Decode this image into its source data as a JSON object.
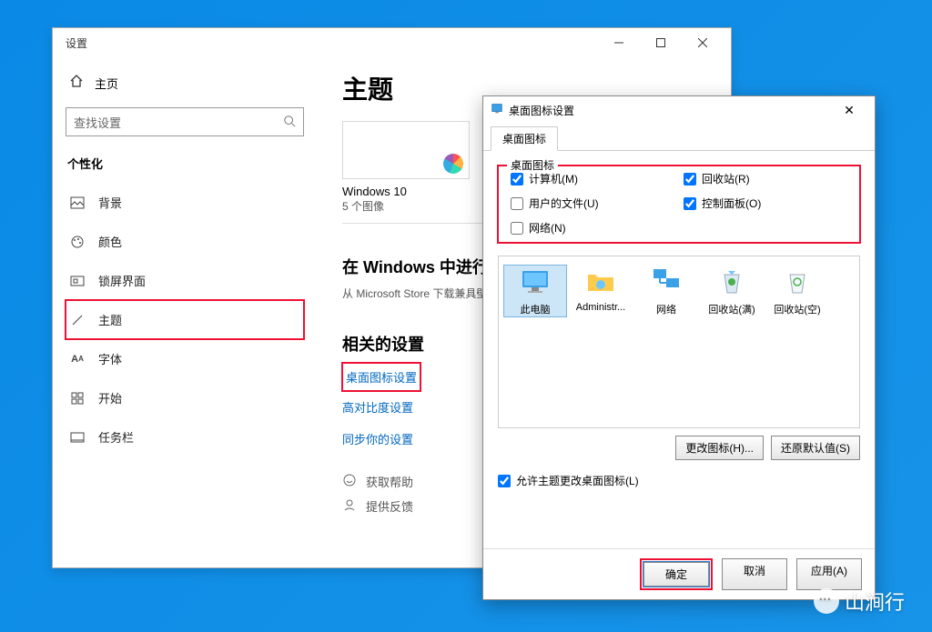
{
  "settings": {
    "title": "设置",
    "home": "主页",
    "search_placeholder": "查找设置",
    "section": "个性化",
    "nav": [
      {
        "label": "背景",
        "icon": "picture-icon"
      },
      {
        "label": "颜色",
        "icon": "palette-icon"
      },
      {
        "label": "锁屏界面",
        "icon": "lock-icon"
      },
      {
        "label": "主题",
        "icon": "brush-icon",
        "selected": true
      },
      {
        "label": "字体",
        "icon": "font-icon"
      },
      {
        "label": "开始",
        "icon": "start-icon"
      },
      {
        "label": "任务栏",
        "icon": "taskbar-icon"
      }
    ],
    "main": {
      "heading": "主题",
      "theme_name": "Windows 10",
      "theme_sub": "5 个图像",
      "more_heading": "在 Windows 中进行更多个性化设置",
      "more_sub": "从 Microsoft Store 下载兼具壁纸、声音和颜色的免费主题",
      "related_heading": "相关的设置",
      "links": {
        "desktop_icon": "桌面图标设置",
        "contrast": "高对比度设置",
        "sync": "同步你的设置"
      },
      "help": "获取帮助",
      "feedback": "提供反馈"
    }
  },
  "dialog": {
    "title": "桌面图标设置",
    "tab": "桌面图标",
    "group_legend": "桌面图标",
    "checkboxes": {
      "computer": {
        "label": "计算机(M)",
        "checked": true
      },
      "recycle": {
        "label": "回收站(R)",
        "checked": true
      },
      "userfiles": {
        "label": "用户的文件(U)",
        "checked": false
      },
      "controlpanel": {
        "label": "控制面板(O)",
        "checked": true
      },
      "network": {
        "label": "网络(N)",
        "checked": false
      }
    },
    "icons": [
      {
        "label": "此电脑",
        "type": "computer"
      },
      {
        "label": "Administr...",
        "type": "folder"
      },
      {
        "label": "网络",
        "type": "network"
      },
      {
        "label": "回收站(满)",
        "type": "recycle-full"
      },
      {
        "label": "回收站(空)",
        "type": "recycle-empty"
      }
    ],
    "buttons": {
      "change_icon": "更改图标(H)...",
      "restore": "还原默认值(S)"
    },
    "allow_theme": "允许主题更改桌面图标(L)",
    "allow_checked": true,
    "footer": {
      "ok": "确定",
      "cancel": "取消",
      "apply": "应用(A)"
    }
  },
  "watermark": "山涧行"
}
